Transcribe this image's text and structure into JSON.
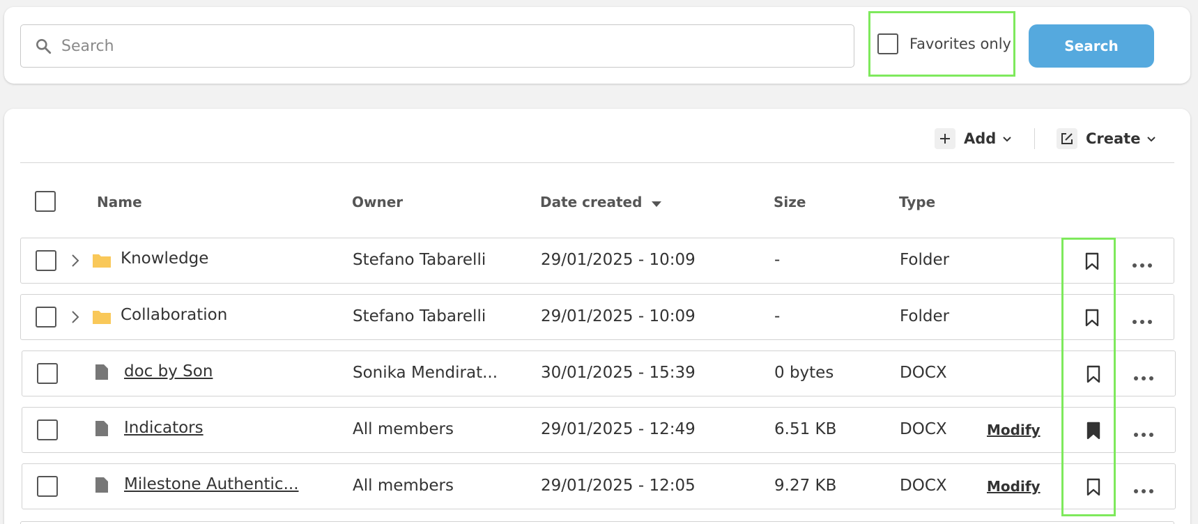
{
  "search": {
    "placeholder": "Search",
    "value": "",
    "favorites_label": "Favorites only",
    "favorites_checked": false,
    "button_label": "Search"
  },
  "toolbar": {
    "add_label": "Add",
    "create_label": "Create"
  },
  "columns": {
    "name": "Name",
    "owner": "Owner",
    "date_created": "Date created",
    "size": "Size",
    "type": "Type"
  },
  "rows": [
    {
      "kind": "folder",
      "name": "Knowledge",
      "owner": "Stefano Tabarelli",
      "date": "29/01/2025 - 10:09",
      "size": "-",
      "type": "Folder",
      "action": "",
      "favorite": false
    },
    {
      "kind": "folder",
      "name": "Collaboration",
      "owner": "Stefano Tabarelli",
      "date": "29/01/2025 - 10:09",
      "size": "-",
      "type": "Folder",
      "action": "",
      "favorite": false
    },
    {
      "kind": "file",
      "name": "doc by Son",
      "owner": "Sonika Mendirat...",
      "date": "30/01/2025 - 15:39",
      "size": "0 bytes",
      "type": "DOCX",
      "action": "",
      "favorite": false
    },
    {
      "kind": "file",
      "name": "Indicators",
      "owner": "All members",
      "date": "29/01/2025 - 12:49",
      "size": "6.51 KB",
      "type": "DOCX",
      "action": "Modify",
      "favorite": true
    },
    {
      "kind": "file",
      "name": "Milestone Authentic...",
      "owner": "All members",
      "date": "29/01/2025 - 12:05",
      "size": "9.27 KB",
      "type": "DOCX",
      "action": "Modify",
      "favorite": false
    }
  ],
  "colors": {
    "accent": "#55a9de",
    "highlight": "#7ee95c",
    "folder": "#f9c859"
  }
}
